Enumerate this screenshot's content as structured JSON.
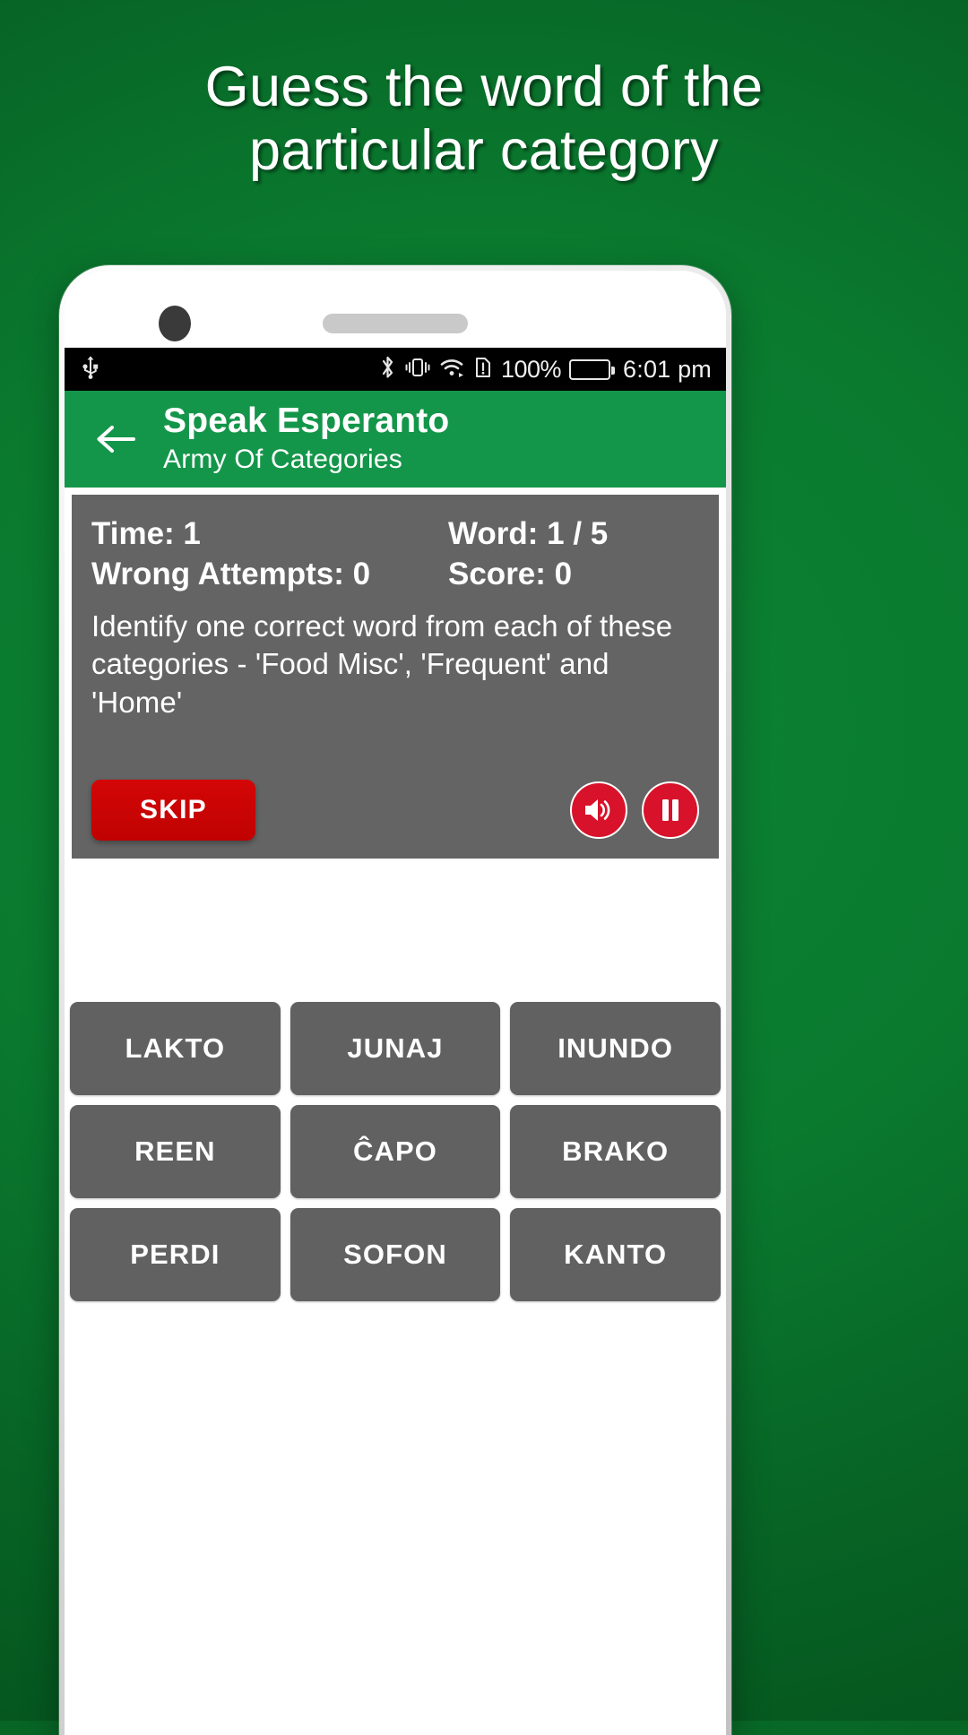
{
  "promo": {
    "headline": "Guess the word of the particular category",
    "background_color": "#0a7a2f"
  },
  "statusbar": {
    "usb_icon": "usb-icon",
    "bluetooth_icon": "bluetooth-icon",
    "vibrate_icon": "vibrate-icon",
    "wifi_icon": "wifi-icon",
    "sim_warning_icon": "sim-card-alert-icon",
    "battery_percent": "100%",
    "battery_icon": "battery-full-icon",
    "time": "6:01 pm"
  },
  "appbar": {
    "back_icon": "back-arrow-icon",
    "title": "Speak Esperanto",
    "subtitle": "Army Of Categories",
    "color": "#14964a"
  },
  "panel": {
    "time_label": "Time: 1",
    "word_label": "Word: 1 / 5",
    "wrong_attempts_label": "Wrong Attempts: 0",
    "score_label": "Score: 0",
    "instruction": "Identify one correct word from each of these categories - 'Food Misc', 'Frequent' and 'Home'",
    "skip_label": "SKIP",
    "sound_icon": "volume-up-icon",
    "pause_icon": "pause-icon",
    "panel_color": "#646464",
    "accent_color": "#c00202"
  },
  "words": [
    "LAKTO",
    "JUNAJ",
    "INUNDO",
    "REEN",
    "ĈAPO",
    "BRAKO",
    "PERDI",
    "SOFON",
    "KANTO"
  ]
}
